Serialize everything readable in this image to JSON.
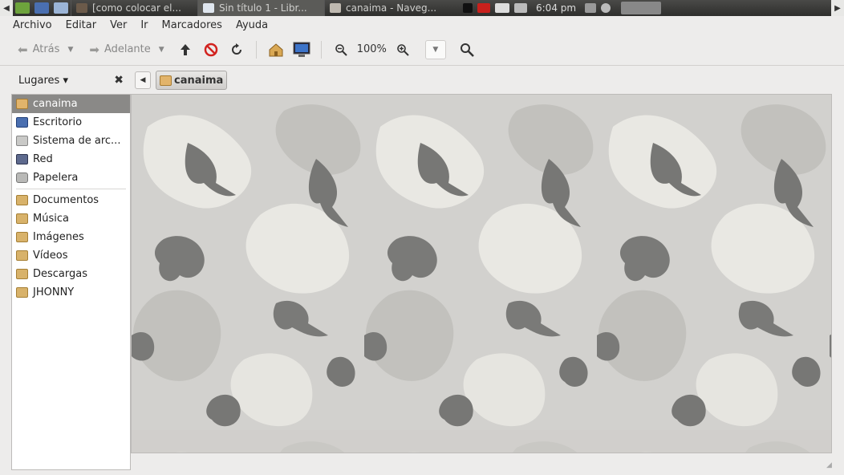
{
  "panel": {
    "tasks": [
      {
        "label": "[como colocar el..."
      },
      {
        "label": "Sin título 1 - Libr..."
      },
      {
        "label": "canaima - Naveg..."
      }
    ],
    "clock": "6:04 pm"
  },
  "menubar": {
    "items": [
      "Archivo",
      "Editar",
      "Ver",
      "Ir",
      "Marcadores",
      "Ayuda"
    ]
  },
  "toolbar": {
    "back_label": "Atrás",
    "forward_label": "Adelante",
    "zoom_level": "100%"
  },
  "sidebar": {
    "header": "Lugares",
    "places": [
      {
        "label": "canaima",
        "icon": "home-folder-icon"
      },
      {
        "label": "Escritorio",
        "icon": "desktop-icon"
      },
      {
        "label": "Sistema de arc...",
        "icon": "drive-icon"
      },
      {
        "label": "Red",
        "icon": "network-icon"
      },
      {
        "label": "Papelera",
        "icon": "trash-icon"
      }
    ],
    "bookmarks": [
      {
        "label": "Documentos"
      },
      {
        "label": "Música"
      },
      {
        "label": "Imágenes"
      },
      {
        "label": "Vídeos"
      },
      {
        "label": "Descargas"
      },
      {
        "label": "JHONNY"
      }
    ]
  },
  "pathbar": {
    "current": "canaima"
  },
  "colors": {
    "selection": "#8a8987",
    "folder": "#d8b26a",
    "camo_light": "#e9e8e3",
    "camo_mid": "#c9c8c5",
    "camo_dark": "#777775"
  }
}
